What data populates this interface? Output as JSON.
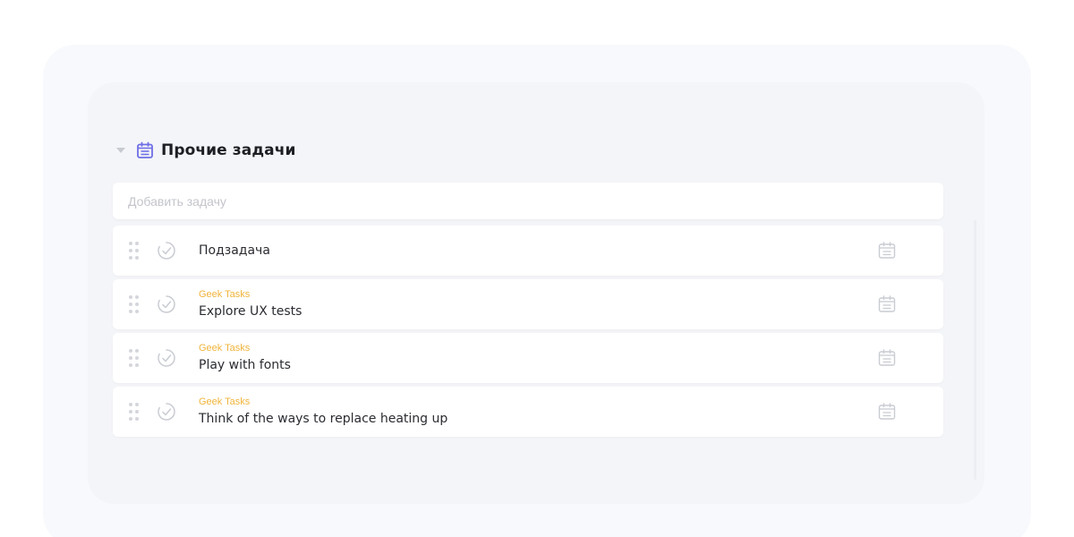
{
  "section": {
    "title": "Прочие задачи",
    "icon": "calendar-icon",
    "accent_color": "#6f6fe6"
  },
  "add_task": {
    "placeholder": "Добавить задачу",
    "value": ""
  },
  "tasks": [
    {
      "project": "",
      "title": "Подзадача"
    },
    {
      "project": "Geek Tasks",
      "title": "Explore UX tests"
    },
    {
      "project": "Geek Tasks",
      "title": "Play with fonts"
    },
    {
      "project": "Geek Tasks",
      "title": "Think of the ways to replace heating up"
    }
  ],
  "colors": {
    "project_label": "#f0b43a",
    "icon_muted": "#c9ccd2"
  }
}
